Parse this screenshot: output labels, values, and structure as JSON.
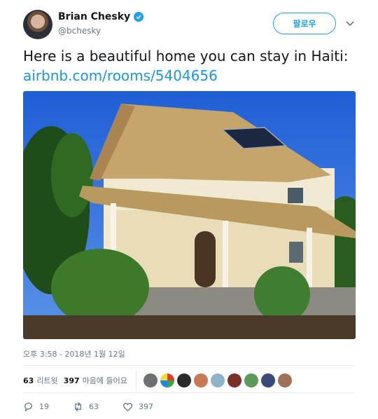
{
  "author": {
    "name": "Brian Chesky",
    "handle": "@bchesky",
    "verified": true
  },
  "follow_button": {
    "label": "팔로우"
  },
  "tweet": {
    "text_plain": "Here is a beautiful home you can stay in Haiti: ",
    "link_text": "airbnb.com/rooms/5404656",
    "timestamp": "오후 3:58 - 2018년 1월 12일"
  },
  "photo": {
    "alt_description_icon": "thatched-house-photo"
  },
  "stats": {
    "retweets_count": "63",
    "retweets_label": "리트윗",
    "likes_count": "397",
    "likes_label": "마음에 들어요",
    "liker_avatars": 9
  },
  "actions": {
    "reply_count": "19",
    "retweet_count": "63",
    "like_count": "397"
  },
  "colors": {
    "accent": "#1da1f2",
    "link": "#1b95e0",
    "muted": "#657786",
    "text": "#14171a"
  }
}
